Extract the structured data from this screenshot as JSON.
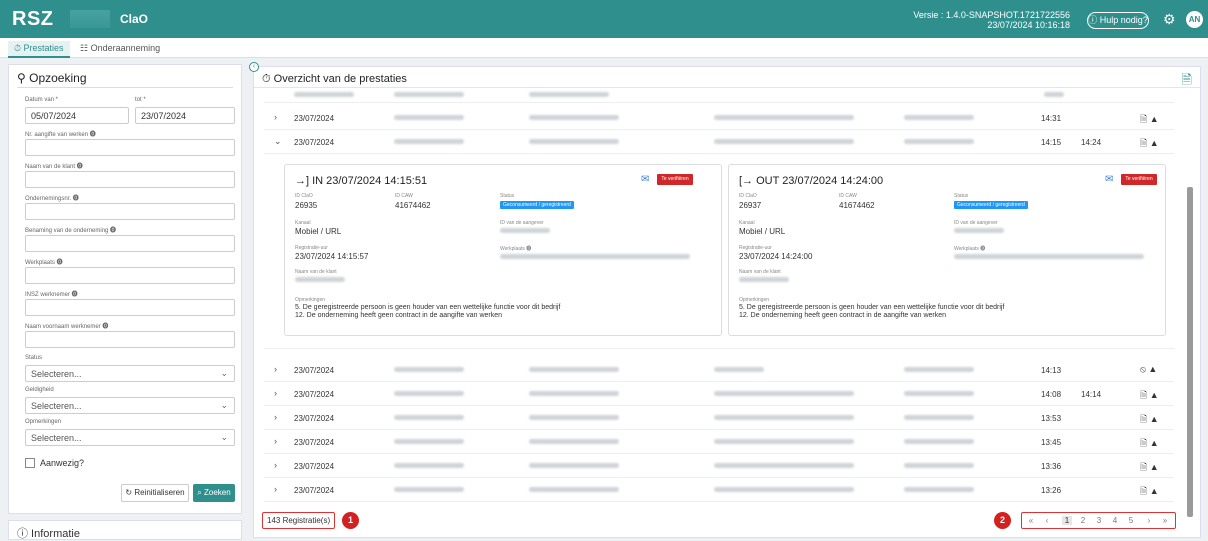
{
  "header": {
    "logo": "RSZ",
    "app": "ClaO",
    "version_line1": "Versie : 1.4.0-SNAPSHOT.1721722556",
    "version_line2": "23/07/2024 10:16:18",
    "help": "ⓘ Hulp nodig?",
    "avatar": "AN"
  },
  "tabs": [
    {
      "label": "⏱ Prestaties"
    },
    {
      "label": "☷ Onderaanneming"
    }
  ],
  "search": {
    "title": "Opzoeking",
    "date_from_label": "Datum van *",
    "date_from": "05/07/2024",
    "date_to_label": "tot *",
    "date_to": "23/07/2024",
    "f1": "Nr. aangifte van werken ⓿",
    "f2": "Naam van de klant ⓿",
    "f3": "Ondernemingsnr. ⓿",
    "f4": "Benaming van de onderneming ⓿",
    "f5": "Werkplaats ⓿",
    "f6": "INSZ werknemer ⓿",
    "f7": "Naam voornaam werknemer ⓿",
    "status_label": "Status",
    "status_value": "Selecteren...",
    "geldigheid_label": "Geldigheid",
    "geldigheid_value": "Selecteren...",
    "opm_label": "Opmerkingen",
    "opm_value": "Selecteren...",
    "aanwezig": "Aanwezig?",
    "reset": "↻ Reinitialiseren",
    "zoek": "⌕ Zoeken"
  },
  "info": {
    "title": "ⓘ Informatie"
  },
  "main": {
    "title": "Overzicht van de prestaties"
  },
  "rows": [
    {
      "date": "23/07/2024",
      "in": "14:31",
      "out": "",
      "icons": "🗎 ▲",
      "arrow": "›"
    },
    {
      "date": "23/07/2024",
      "in": "14:15",
      "out": "14:24",
      "icons": "🗎 ▲",
      "arrow": "⌄"
    },
    {
      "date": "23/07/2024",
      "in": "14:13",
      "out": "",
      "icons": "⦸ ▲",
      "arrow": "›"
    },
    {
      "date": "23/07/2024",
      "in": "14:08",
      "out": "14:14",
      "icons": "🗎 ▲",
      "arrow": "›"
    },
    {
      "date": "23/07/2024",
      "in": "13:53",
      "out": "",
      "icons": "🗎 ▲",
      "arrow": "›"
    },
    {
      "date": "23/07/2024",
      "in": "13:45",
      "out": "",
      "icons": "🗎 ▲",
      "arrow": "›"
    },
    {
      "date": "23/07/2024",
      "in": "13:36",
      "out": "",
      "icons": "🗎 ▲",
      "arrow": "›"
    },
    {
      "date": "23/07/2024",
      "in": "13:26",
      "out": "",
      "icons": "🗎 ▲",
      "arrow": "›"
    }
  ],
  "card_in": {
    "title": "→] IN 23/07/2024 14:15:51",
    "badge": "Te verifiëren",
    "id_clao_l": "ID ClaO",
    "id_clao": "26935",
    "id_caw_l": "ID CAW",
    "id_caw": "41674462",
    "status_l": "Status",
    "status": "Geconsumeerd / geregistreerd",
    "kanaal_l": "Kanaal",
    "kanaal": "Mobiel / URL",
    "aang_l": "ID van de aangever",
    "reg_l": "Registratie-uur",
    "reg": "23/07/2024 14:15:57",
    "wp_l": "Werkplaats ⓿",
    "klant_l": "Naam van de klant",
    "opm_l": "Opmerkingen",
    "opm1": "5. De geregistreerde persoon is geen houder van een wettelijke functie voor dit bedrijf",
    "opm2": "12. De onderneming heeft geen contract in de aangifte van werken"
  },
  "card_out": {
    "title": "[→ OUT 23/07/2024 14:24:00",
    "badge": "Te verifiëren",
    "id_clao_l": "ID ClaO",
    "id_clao": "26937",
    "id_caw_l": "ID CAW",
    "id_caw": "41674462",
    "status_l": "Status",
    "status": "Geconsumeerd / geregistreerd",
    "kanaal_l": "Kanaal",
    "kanaal": "Mobiel / URL",
    "aang_l": "ID van de aangever",
    "reg_l": "Registratie-uur",
    "reg": "23/07/2024 14:24:00",
    "wp_l": "Werkplaats ⓿",
    "klant_l": "Naam van de klant",
    "opm_l": "Opmerkingen",
    "opm1": "5. De geregistreerde persoon is geen houder van een wettelijke functie voor dit bedrijf",
    "opm2": "12. De onderneming heeft geen contract in de aangifte van werken"
  },
  "footer": {
    "count": "143 Registratie(s)",
    "marker1": "1",
    "marker2": "2",
    "pages": [
      "1",
      "2",
      "3",
      "4",
      "5"
    ],
    "first": "«",
    "prev": "‹",
    "next": "›",
    "last": "»"
  }
}
